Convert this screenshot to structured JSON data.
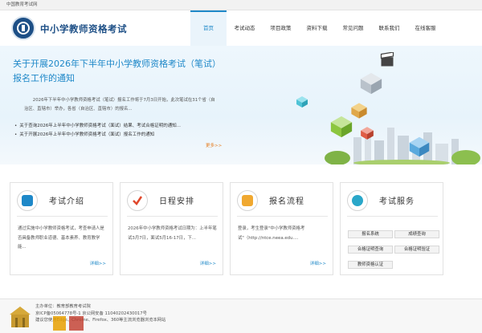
{
  "topbar": {
    "text": "中国教育考试网"
  },
  "header": {
    "site_title": "中小学教师资格考试",
    "nav": [
      "首页",
      "考试动态",
      "项目政策",
      "资料下载",
      "常见问题",
      "联系我们",
      "在线客服"
    ],
    "active_index": 0
  },
  "banner": {
    "title": "关于开展2026年下半年中小学教师资格考试（笔试）报名工作的通知",
    "description": "2026年下半年中小学教师资格考试（笔试）报名工作将于7月3日开始，此次笔试在31个省（自治区、直辖市）举办，各省（自治区、直辖市）的报名...",
    "news": [
      "关于查询2026年上半年中小学教师资格考试（面试）结果、考试合格证明的通知...",
      "关于开展2026年上半年中小学教师资格考试（面试）报名工作的通知"
    ],
    "more": "更多>>"
  },
  "cards": [
    {
      "title": "考试介绍",
      "text": "通过实施中小学教师资格考试，考查申请人是否具备教师职业道德、基本素养、教育教学能...",
      "more": "详细>>",
      "icon": "document-icon",
      "color": "#1e88c8"
    },
    {
      "title": "日程安排",
      "text": "2026年中小学教师资格考试日期为：上半年笔试3月7日，面试5月16-17日，下...",
      "more": "详细>>",
      "icon": "checkmark-icon",
      "color": "#e0482c"
    },
    {
      "title": "报名流程",
      "text": "登录，考生登录\"中小学教师资格考试\"（http://ntce.neea.edu....",
      "more": "详细>>",
      "icon": "form-icon",
      "color": "#f0a830"
    },
    {
      "title": "考试服务",
      "icon": "headset-icon",
      "color": "#2aa7c9",
      "buttons": [
        "报名系统",
        "成绩查询",
        "合格证明查询",
        "合格证明验证",
        "教师资格认证"
      ]
    }
  ],
  "footer": {
    "lines": [
      "主办单位：教育部教育考试院",
      "京ICP备05064778号-1   京公网安备 11040202430017号",
      "建议您使用Edge、Chrome、Firefox、360等主流浏览器浏览本网站"
    ]
  }
}
